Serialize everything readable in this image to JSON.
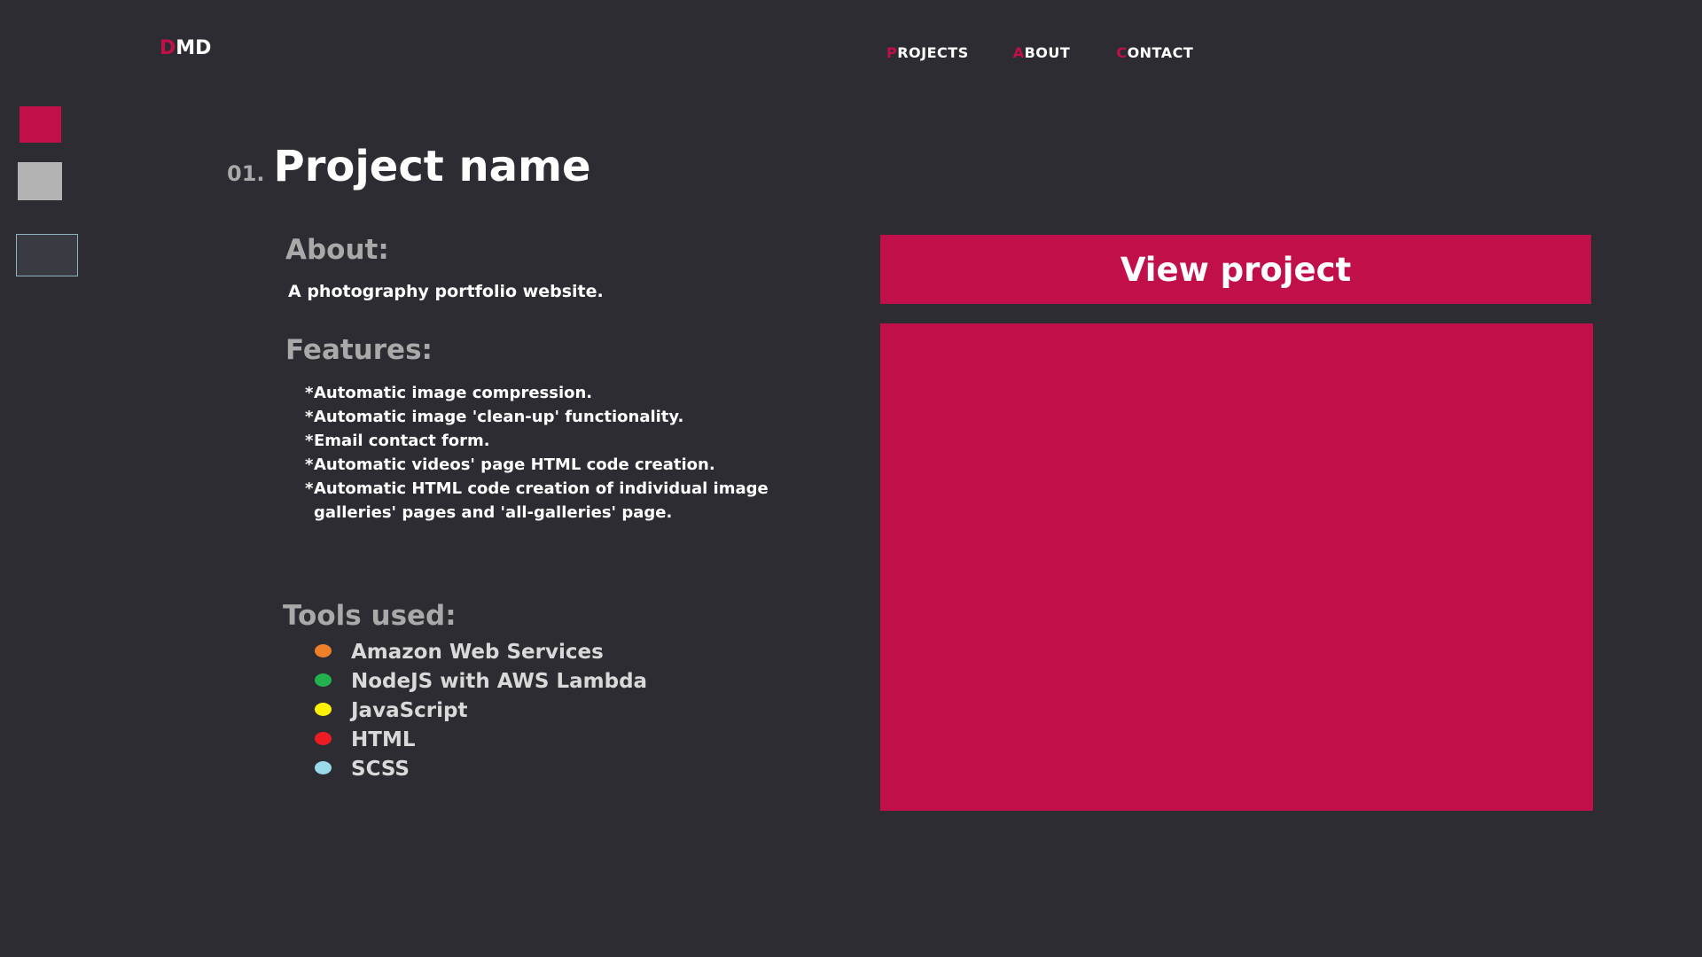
{
  "colors": {
    "background": "#2c2c32",
    "accent": "#c10f4a",
    "heading_grey": "#a9a9a9",
    "text_white": "#ffffff",
    "side_square_grey": "#b3b3b3",
    "side_square_outline": "#8fb2bd"
  },
  "logo": {
    "first_letter": "D",
    "rest": "MD"
  },
  "nav": {
    "items": [
      {
        "first_letter": "P",
        "rest": "ROJECTS"
      },
      {
        "first_letter": "A",
        "rest": "BOUT"
      },
      {
        "first_letter": "C",
        "rest": "ONTACT"
      }
    ]
  },
  "project": {
    "number": "01.",
    "title": "Project name",
    "about_heading": "About:",
    "about_text": "A photography portfolio website.",
    "features_heading": "Features:",
    "features": [
      "Automatic image compression.",
      "Automatic image 'clean-up' functionality.",
      "Email contact form.",
      "Automatic videos' page HTML code creation.",
      "Automatic HTML code creation of individual image galleries' pages and 'all-galleries' page."
    ],
    "feature_bullet": "*",
    "tools_heading": "Tools used:",
    "tools": [
      {
        "name": "Amazon Web Services",
        "color": "#f07f2a"
      },
      {
        "name": "NodeJS with AWS Lambda",
        "color": "#22b14c"
      },
      {
        "name": "JavaScript",
        "color": "#fff200"
      },
      {
        "name": "HTML",
        "color": "#ed1c24"
      },
      {
        "name": "SCSS",
        "color": "#99d9ea"
      }
    ],
    "view_button_label": "View project"
  }
}
